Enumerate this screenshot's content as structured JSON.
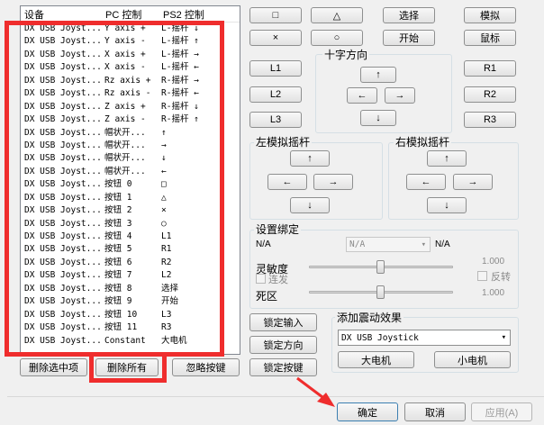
{
  "list": {
    "headers": [
      "设备",
      "PC 控制",
      "PS2 控制"
    ],
    "rows": [
      [
        "DX USB Joyst...",
        "Y axis +",
        "L-摇杆 ↓"
      ],
      [
        "DX USB Joyst...",
        "Y axis -",
        "L-摇杆 ↑"
      ],
      [
        "DX USB Joyst...",
        "X axis +",
        "L-摇杆 →"
      ],
      [
        "DX USB Joyst...",
        "X axis -",
        "L-摇杆 ←"
      ],
      [
        "DX USB Joyst...",
        "Rz axis +",
        "R-摇杆 →"
      ],
      [
        "DX USB Joyst...",
        "Rz axis -",
        "R-摇杆 ←"
      ],
      [
        "DX USB Joyst...",
        "Z axis +",
        "R-摇杆 ↓"
      ],
      [
        "DX USB Joyst...",
        "Z axis -",
        "R-摇杆 ↑"
      ],
      [
        "DX USB Joyst...",
        "帽状开...",
        "↑"
      ],
      [
        "DX USB Joyst...",
        "帽状开...",
        "→"
      ],
      [
        "DX USB Joyst...",
        "帽状开...",
        "↓"
      ],
      [
        "DX USB Joyst...",
        "帽状开...",
        "←"
      ],
      [
        "DX USB Joyst...",
        "按钮 0",
        "□"
      ],
      [
        "DX USB Joyst...",
        "按钮 1",
        "△"
      ],
      [
        "DX USB Joyst...",
        "按钮 2",
        "×"
      ],
      [
        "DX USB Joyst...",
        "按钮 3",
        "○"
      ],
      [
        "DX USB Joyst...",
        "按钮 4",
        "L1"
      ],
      [
        "DX USB Joyst...",
        "按钮 5",
        "R1"
      ],
      [
        "DX USB Joyst...",
        "按钮 6",
        "R2"
      ],
      [
        "DX USB Joyst...",
        "按钮 7",
        "L2"
      ],
      [
        "DX USB Joyst...",
        "按钮 8",
        "选择"
      ],
      [
        "DX USB Joyst...",
        "按钮 9",
        "开始"
      ],
      [
        "DX USB Joyst...",
        "按钮 10",
        "L3"
      ],
      [
        "DX USB Joyst...",
        "按钮 11",
        "R3"
      ],
      [
        "DX USB Joyst...",
        "Constant",
        "大电机"
      ]
    ]
  },
  "list_buttons": {
    "delete_selected": "删除选中项",
    "delete_all": "删除所有",
    "ignore_keys": "忽略按键"
  },
  "pad": {
    "square": "□",
    "triangle": "△",
    "select": "选择",
    "analog": "模拟",
    "cross": "×",
    "circle": "○",
    "start": "开始",
    "mouse": "鼠标",
    "l1": "L1",
    "l2": "L2",
    "l3": "L3",
    "r1": "R1",
    "r2": "R2",
    "r3": "R3",
    "up": "↑",
    "down": "↓",
    "left": "←",
    "right": "→"
  },
  "dpad": {
    "title": "十字方向"
  },
  "left_stick": {
    "title": "左模拟摇杆"
  },
  "right_stick": {
    "title": "右模拟摇杆"
  },
  "binding": {
    "title": "设置绑定",
    "na_left": "N/A",
    "na_select": "N/A",
    "na_right": "N/A",
    "sensitivity_label": "灵敏度",
    "sensitivity_value": "1.000",
    "turbo_label": "连发",
    "invert_label": "反转",
    "deadzone_label": "死区",
    "deadzone_value": "1.000",
    "sensitivity_level": 0.5,
    "deadzone_level": 0.5
  },
  "actions": {
    "lock_input": "锁定输入",
    "lock_direction": "锁定方向",
    "lock_buttons": "锁定按键"
  },
  "rumble": {
    "title": "添加震动效果",
    "device": "DX USB Joystick",
    "big_motor": "大电机",
    "small_motor": "小电机"
  },
  "dialog": {
    "ok": "确定",
    "cancel": "取消",
    "apply": "应用(A)"
  },
  "colors": {
    "annotation": "#ef2d2d"
  }
}
